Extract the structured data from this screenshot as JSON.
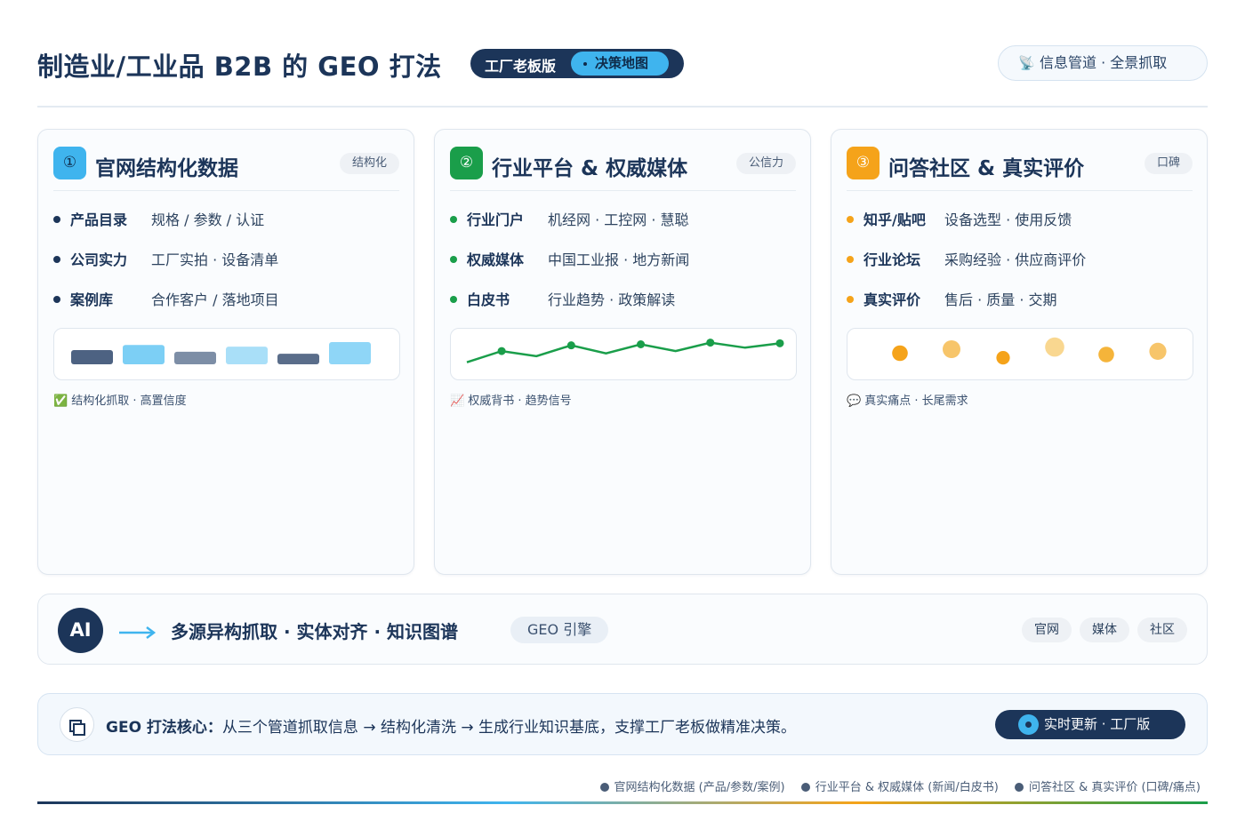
{
  "header": {
    "title": "制造业/工业品 B2B 的 GEO 打法",
    "version_left": "工厂老板版",
    "version_right": "决策地图",
    "pipe_icon": "satellite-dish-icon",
    "pipe_label": "信息管道 · 全景抓取"
  },
  "cards": [
    {
      "num": "①",
      "title": "官网结构化数据",
      "tag": "结构化",
      "accent": "#3fb4ee",
      "bullet": "#1c3559",
      "rows": [
        {
          "k": "产品目录",
          "v": "规格 / 参数 / 认证"
        },
        {
          "k": "公司实力",
          "v": "工厂实拍 · 设备清单"
        },
        {
          "k": "案例库",
          "v": "合作客户 / 落地项目"
        }
      ],
      "foot_icon": "✅",
      "foot": "结构化抓取 · 高置信度"
    },
    {
      "num": "②",
      "title": "行业平台 & 权威媒体",
      "tag": "公信力",
      "accent": "#1a9e4a",
      "bullet": "#1a9e4a",
      "rows": [
        {
          "k": "行业门户",
          "v": "机经网 · 工控网 · 慧聪"
        },
        {
          "k": "权威媒体",
          "v": "中国工业报 · 地方新闻"
        },
        {
          "k": "白皮书",
          "v": "行业趋势 · 政策解读"
        }
      ],
      "foot_icon": "📈",
      "foot": "权威背书 · 趋势信号"
    },
    {
      "num": "③",
      "title": "问答社区 & 真实评价",
      "tag": "口碑",
      "accent": "#f5a31a",
      "bullet": "#f5a31a",
      "rows": [
        {
          "k": "知乎/贴吧",
          "v": "设备选型 · 使用反馈"
        },
        {
          "k": "行业论坛",
          "v": "采购经验 · 供应商评价"
        },
        {
          "k": "真实评价",
          "v": "售后 · 质量 · 交期"
        }
      ],
      "foot_icon": "💬",
      "foot": "真实痛点 · 长尾需求"
    }
  ],
  "ai_bar": {
    "badge": "AI",
    "flow": "多源异构抓取 · 实体对齐 · 知识图谱",
    "engine": "GEO 引擎",
    "sources": [
      "官网",
      "媒体",
      "社区"
    ]
  },
  "core": {
    "label": "GEO 打法核心：",
    "text": "从三个管道抓取信息 → 结构化清洗 → 生成行业知识基底，支撑工厂老板做精准决策。",
    "live": "实时更新 · 工厂版"
  },
  "legend": [
    "官网结构化数据 (产品/参数/案例)",
    "行业平台 & 权威媒体 (新闻/白皮书)",
    "问答社区 & 真实评价 (口碑/痛点)"
  ],
  "viz": {
    "bars": [
      {
        "level": 0.5,
        "color": "#4d6282"
      },
      {
        "level": 0.68,
        "color": "#7ccff5"
      },
      {
        "level": 0.44,
        "color": "#7d8ea6"
      },
      {
        "level": 0.62,
        "color": "#a9dff8"
      },
      {
        "level": 0.37,
        "color": "#5a6d8a"
      },
      {
        "level": 0.78,
        "color": "#8fd6f7"
      }
    ],
    "line": [
      0.22,
      0.55,
      0.4,
      0.72,
      0.48,
      0.75,
      0.55,
      0.8,
      0.65,
      0.78
    ],
    "line_color": "#1a9e4a",
    "dots": [
      {
        "level": 0.55,
        "size": 0.6,
        "color": "#f5a31a"
      },
      {
        "level": 0.7,
        "size": 0.75,
        "color": "#f7c56a"
      },
      {
        "level": 0.38,
        "size": 0.45,
        "color": "#f5a31a"
      },
      {
        "level": 0.78,
        "size": 0.85,
        "color": "#f9d790"
      },
      {
        "level": 0.5,
        "size": 0.6,
        "color": "#f5b43a"
      },
      {
        "level": 0.62,
        "size": 0.7,
        "color": "#f7c56a"
      }
    ]
  }
}
